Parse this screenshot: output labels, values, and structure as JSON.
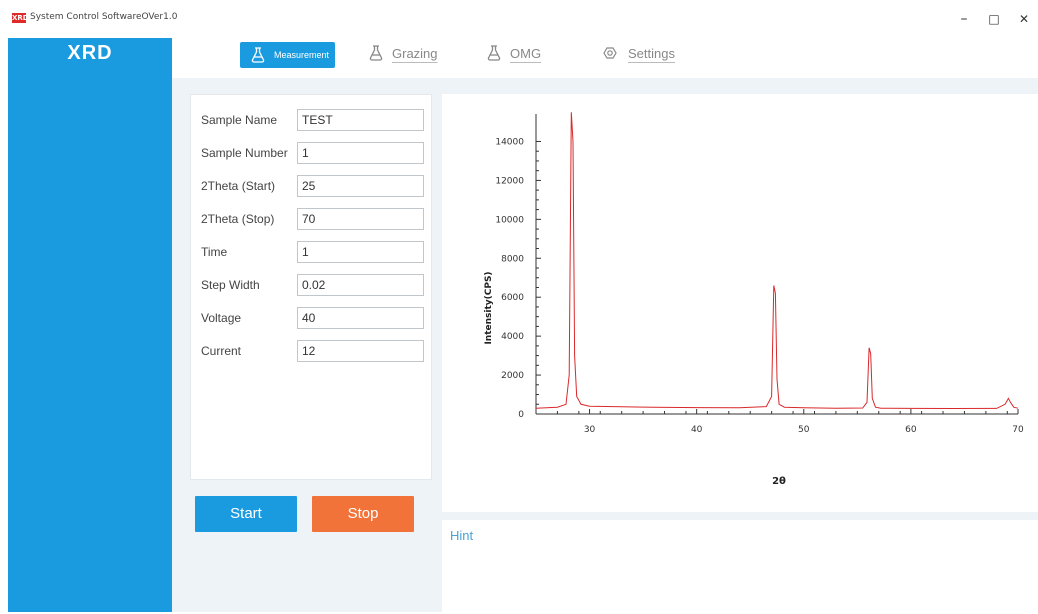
{
  "window": {
    "title": "System Control SoftwareOVer1.0",
    "icon_text": "XRD",
    "minimize": "–",
    "maximize": "□",
    "close": "✕"
  },
  "sidebar": {
    "title": "XRD"
  },
  "tabs": [
    {
      "label": "Measurement",
      "icon": "flask-icon",
      "active": true
    },
    {
      "label": "Grazing",
      "icon": "flask-icon",
      "active": false
    },
    {
      "label": "OMG",
      "icon": "flask-icon",
      "active": false
    },
    {
      "label": "Settings",
      "icon": "gear-icon",
      "active": false
    }
  ],
  "form": {
    "fields": [
      {
        "label": "Sample Name",
        "value": "TEST"
      },
      {
        "label": "Sample Number",
        "value": "1"
      },
      {
        "label": "2Theta (Start)",
        "value": "25"
      },
      {
        "label": "2Theta (Stop)",
        "value": "70"
      },
      {
        "label": "Time",
        "value": "1"
      },
      {
        "label": "Step Width",
        "value": "0.02"
      },
      {
        "label": "Voltage",
        "value": "40"
      },
      {
        "label": "Current",
        "value": "12"
      }
    ]
  },
  "buttons": {
    "start": "Start",
    "stop": "Stop"
  },
  "hint": {
    "label": "Hint"
  },
  "colors": {
    "accent": "#1a9be0",
    "stop": "#f2733a",
    "line": "#d9282a"
  },
  "chart_data": {
    "type": "line",
    "xlabel": "2θ",
    "ylabel": "Intensity(CPS)",
    "xlim": [
      25,
      70
    ],
    "ylim": [
      0,
      15000
    ],
    "xticks": [
      30,
      40,
      50,
      60,
      70
    ],
    "yticks": [
      0,
      2000,
      4000,
      6000,
      8000,
      10000,
      12000,
      14000
    ],
    "grid": false,
    "series": [
      {
        "x": [
          25,
          26,
          27,
          27.8,
          28.1,
          28.3,
          28.45,
          28.6,
          28.8,
          29.2,
          30,
          33,
          36,
          40,
          44,
          46.5,
          47.0,
          47.2,
          47.35,
          47.5,
          47.7,
          48.2,
          50,
          53,
          55.5,
          55.9,
          56.1,
          56.25,
          56.4,
          56.7,
          57.2,
          60,
          64,
          68,
          68.8,
          69.1,
          69.3,
          69.6,
          70
        ],
        "y": [
          300,
          320,
          350,
          500,
          2000,
          15500,
          14000,
          3000,
          900,
          500,
          400,
          370,
          350,
          330,
          320,
          380,
          900,
          6600,
          6200,
          1800,
          500,
          350,
          320,
          300,
          310,
          600,
          3400,
          3100,
          800,
          350,
          300,
          290,
          280,
          290,
          500,
          800,
          600,
          350,
          300
        ]
      }
    ]
  }
}
